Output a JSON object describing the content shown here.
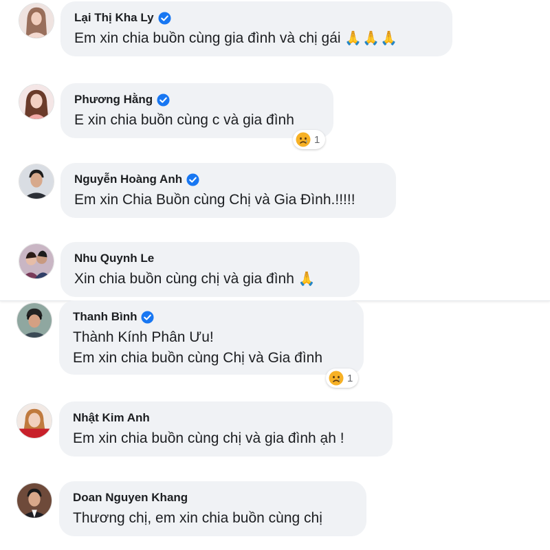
{
  "colors": {
    "bubble": "#f0f2f5",
    "verified_badge": "#1877f2",
    "text": "#1c1e21",
    "reaction_face": "#f7b125"
  },
  "comments": [
    {
      "author": "Lại Thị Kha Ly",
      "verified": true,
      "lines": [
        "Em xin chia buồn cùng gia đình và chị gái"
      ],
      "emoji": "🙏🙏🙏",
      "emoji_icon": "folded-hands-icon"
    },
    {
      "author": "Phương Hằng",
      "verified": true,
      "lines": [
        "E xin chia buồn cùng c và gia đình"
      ],
      "reaction": {
        "icon": "sad-face-icon",
        "count": "1"
      }
    },
    {
      "author": "Nguyễn Hoàng Anh",
      "verified": true,
      "lines": [
        "Em xin Chia Buồn cùng Chị và Gia Đình.!!!!!"
      ]
    },
    {
      "author": "Nhu Quynh Le",
      "verified": false,
      "lines": [
        "Xin chia buồn cùng chị và gia đình"
      ],
      "emoji": "🙏",
      "emoji_icon": "folded-hands-icon"
    },
    {
      "author": "Thanh Bình",
      "verified": true,
      "lines": [
        "Thành Kính Phân Ưu!",
        "Em xin chia buồn cùng Chị và Gia đình"
      ],
      "reaction": {
        "icon": "sad-face-icon",
        "count": "1"
      }
    },
    {
      "author": "Nhật Kim Anh",
      "verified": false,
      "lines": [
        "Em xin chia buồn cùng chị và gia đình ạh !"
      ]
    },
    {
      "author": "Doan Nguyen Khang",
      "verified": false,
      "lines": [
        "Thương chị, em xin chia buồn cùng chị"
      ]
    }
  ]
}
